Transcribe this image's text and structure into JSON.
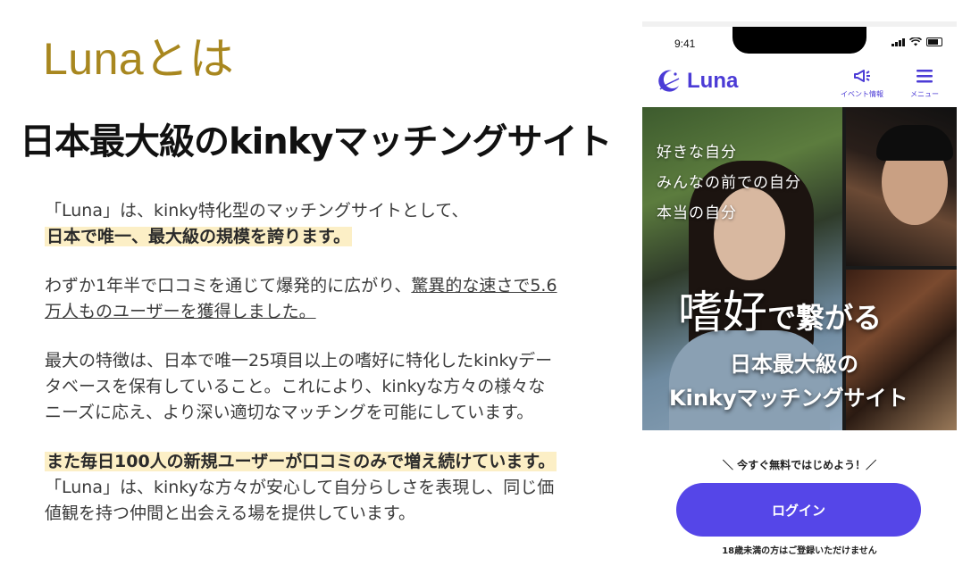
{
  "title": "Lunaとは",
  "subtitle": "日本最大級のkinkyマッチングサイト",
  "paragraphs": {
    "p1_line1": "「Luna」は、kinky特化型のマッチングサイトとして、",
    "p1_highlight": "日本で唯一、最大級の規模を誇ります。",
    "p2_line1_plain": "わずか1年半で口コミを通じて爆発的に広がり、",
    "p2_line1_underline": "驚異的な速さで5.6",
    "p2_line2_underline": "万人ものユーザーを獲得しました。",
    "p3_line1": "最大の特徴は、日本で唯一25項目以上の嗜好に特化したkinkyデー",
    "p3_line2": "タベースを保有していること。これにより、kinkyな方々の様々な",
    "p3_line3": "ニーズに応え、より深い適切なマッチングを可能にしています。",
    "p4_highlight": "また毎日100人の新規ユーザーが口コミのみで増え続けています。",
    "p4_line2": "「Luna」は、kinkyな方々が安心して自分らしさを表現し、同じ価",
    "p4_line3": "値観を持つ仲間と出会える場を提供しています。"
  },
  "phone": {
    "time": "9:41",
    "logo_text": "Luna",
    "nav": {
      "event_label": "イベント情報",
      "menu_label": "メニュー"
    },
    "hero": {
      "small_lines": [
        "好きな自分",
        "みんなの前での自分",
        "本当の自分"
      ],
      "big_kanji": "嗜好",
      "big_rest": "で繋がる",
      "line2": "日本最大級の",
      "line3": "Kinkyマッチングサイト"
    },
    "cta_text": "＼ 今すぐ無料ではじめよう！／",
    "login_label": "ログイン",
    "age_note": "18歳未満の方はご登録いただけません"
  },
  "colors": {
    "title_gold": "#a8871f",
    "highlight": "#fcefc6",
    "brand_purple": "#5546e8",
    "logo_purple": "#4b3bd6"
  }
}
